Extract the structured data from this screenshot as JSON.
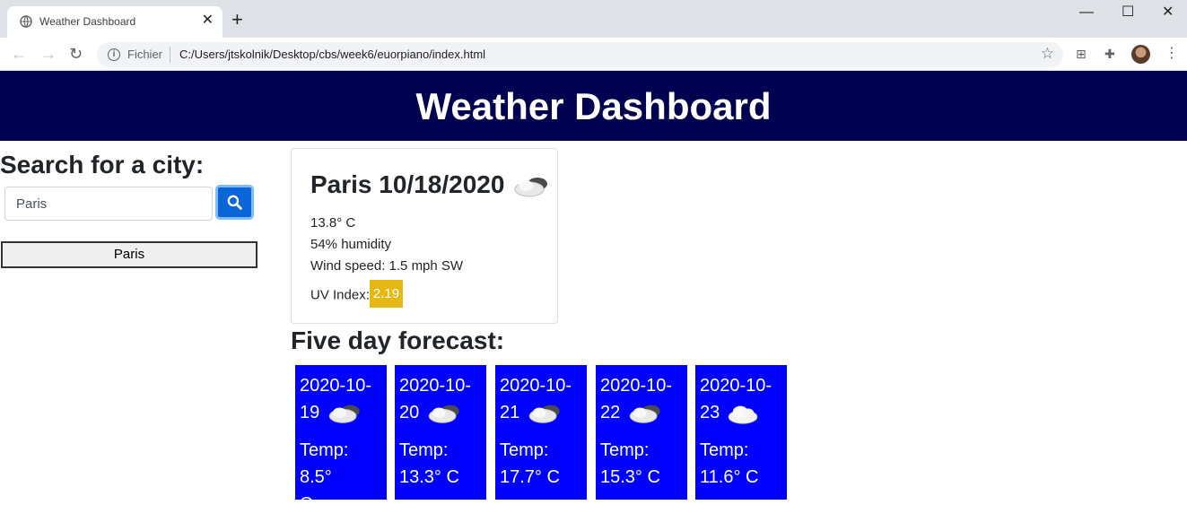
{
  "browser": {
    "tab_title": "Weather Dashboard",
    "url_scheme": "Fichier",
    "url": "C:/Users/jtskolnik/Desktop/cbs/week6/euorpiano/index.html"
  },
  "page": {
    "title": "Weather Dashboard",
    "search_heading": "Search for a city:",
    "search_value": "Paris",
    "history": [
      "Paris"
    ]
  },
  "current": {
    "title": "Paris 10/18/2020",
    "temp": "13.8° C",
    "humidity": "54% humidity",
    "wind": "Wind speed: 1.5 mph SW",
    "uv_label": "UV Index:",
    "uv_value": "2.19",
    "uv_color": "#e5b814",
    "icon": "partly-cloudy-icon"
  },
  "forecast": {
    "heading": "Five day forecast:",
    "days": [
      {
        "date_line1": "2020-10-",
        "date_line2": "19",
        "temp_line1": "Temp: 8.5°",
        "temp_line2": "C",
        "icon": "partly-cloudy-icon"
      },
      {
        "date_line1": "2020-10-",
        "date_line2": "20",
        "temp_line1": "Temp:",
        "temp_line2": "13.3° C",
        "icon": "partly-cloudy-icon"
      },
      {
        "date_line1": "2020-10-",
        "date_line2": "21",
        "temp_line1": "Temp:",
        "temp_line2": "17.7° C",
        "icon": "partly-cloudy-icon"
      },
      {
        "date_line1": "2020-10-",
        "date_line2": "22",
        "temp_line1": "Temp:",
        "temp_line2": "15.3° C",
        "icon": "partly-cloudy-icon"
      },
      {
        "date_line1": "2020-10-",
        "date_line2": "23",
        "temp_line1": "Temp:",
        "temp_line2": "11.6° C",
        "icon": "cloud-icon"
      }
    ]
  },
  "colors": {
    "header_bg": "#000050",
    "forecast_bg": "#0000ff",
    "search_button": "#0a66d8"
  }
}
